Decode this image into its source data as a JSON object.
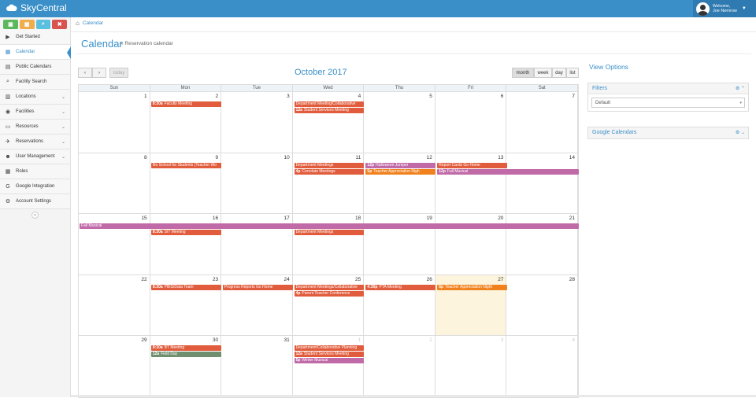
{
  "app": {
    "name": "SkyCentral"
  },
  "user": {
    "welcome": "Welcome,",
    "name": "Joe Nemrow"
  },
  "colors": {
    "brand": "#3a8fc8",
    "event_red": "#e15c3c",
    "event_orange": "#f0811d",
    "event_purple": "#c06aa8",
    "event_green": "#6f8f6e"
  },
  "quick_buttons": [
    {
      "icon": "calendar-plus-icon",
      "symbol": "▣",
      "color": "#5cb85c"
    },
    {
      "icon": "calendar-icon",
      "symbol": "▦",
      "color": "#f0ad4e"
    },
    {
      "icon": "search-icon",
      "symbol": "⌕",
      "color": "#5bc0de"
    },
    {
      "icon": "close-icon",
      "symbol": "✖",
      "color": "#d9534f"
    }
  ],
  "sidebar": {
    "items": [
      {
        "label": "Get Started",
        "icon": "play-icon",
        "symbol": "▶",
        "chevron": ""
      },
      {
        "label": "Calendar",
        "icon": "calendar-icon",
        "symbol": "▦",
        "chevron": "",
        "active": true
      },
      {
        "label": "Public Calendars",
        "icon": "document-icon",
        "symbol": "▤",
        "chevron": ""
      },
      {
        "label": "Facility Search",
        "icon": "search-icon",
        "symbol": "⌕",
        "chevron": ""
      },
      {
        "label": "Locations",
        "icon": "building-icon",
        "symbol": "▥",
        "chevron": "⌄"
      },
      {
        "label": "Facilities",
        "icon": "soccer-ball-icon",
        "symbol": "◉",
        "chevron": "⌄"
      },
      {
        "label": "Resources",
        "icon": "monitor-icon",
        "symbol": "▭",
        "chevron": "⌄"
      },
      {
        "label": "Reservations",
        "icon": "plane-icon",
        "symbol": "✈",
        "chevron": "⌄"
      },
      {
        "label": "User Management",
        "icon": "users-icon",
        "symbol": "☻",
        "chevron": "⌄"
      },
      {
        "label": "Roles",
        "icon": "grid-icon",
        "symbol": "▦",
        "chevron": ""
      },
      {
        "label": "Google Integration",
        "icon": "google-icon",
        "symbol": "G",
        "chevron": ""
      },
      {
        "label": "Account Settings",
        "icon": "gear-icon",
        "symbol": "⚙",
        "chevron": ""
      }
    ],
    "collapse_symbol": "«"
  },
  "breadcrumb": {
    "home_symbol": "⌂",
    "label": "Calendar"
  },
  "page": {
    "title": "Calendar",
    "subtitle": "» Reservation calendar"
  },
  "calendar": {
    "prev": "‹",
    "next": "›",
    "today": "today",
    "title": "October 2017",
    "views": [
      "month",
      "week",
      "day",
      "list"
    ],
    "active_view": "month",
    "weekdays": [
      "Sun",
      "Mon",
      "Tue",
      "Wed",
      "Thu",
      "Fri",
      "Sat"
    ],
    "weeks": [
      {
        "days": [
          {
            "n": "1"
          },
          {
            "n": "2"
          },
          {
            "n": "3"
          },
          {
            "n": "4"
          },
          {
            "n": "5"
          },
          {
            "n": "6"
          },
          {
            "n": "7"
          }
        ],
        "events": [
          {
            "col": 1,
            "span": 1,
            "row": 0,
            "time": "8:30a",
            "title": "Faculty Meeting",
            "color": "red"
          },
          {
            "col": 3,
            "span": 1,
            "row": 0,
            "time": "",
            "title": "Department Meeting/Collaborative",
            "color": "red"
          },
          {
            "col": 3,
            "span": 1,
            "row": 1,
            "time": "12a",
            "title": "Student Services Meeting",
            "color": "red"
          }
        ]
      },
      {
        "days": [
          {
            "n": "8"
          },
          {
            "n": "9"
          },
          {
            "n": "10"
          },
          {
            "n": "11"
          },
          {
            "n": "12"
          },
          {
            "n": "13"
          },
          {
            "n": "14"
          }
        ],
        "events": [
          {
            "col": 1,
            "span": 1,
            "row": 0,
            "time": "",
            "title": "No School for Students (Teacher Wo",
            "color": "red"
          },
          {
            "col": 3,
            "span": 1,
            "row": 0,
            "time": "",
            "title": "Department Meetings",
            "color": "red"
          },
          {
            "col": 3,
            "span": 1,
            "row": 1,
            "time": "4p",
            "title": "Correlate Meetings",
            "color": "red"
          },
          {
            "col": 4,
            "span": 1,
            "row": 0,
            "time": "12p",
            "title": "Halloween Jumper",
            "color": "purple"
          },
          {
            "col": 4,
            "span": 1,
            "row": 1,
            "time": "5p",
            "title": "Teacher Appreciation Nigh",
            "color": "orange"
          },
          {
            "col": 5,
            "span": 1,
            "row": 0,
            "time": "",
            "title": "Report Cards Go Home",
            "color": "red"
          },
          {
            "col": 5,
            "span": 2,
            "row": 1,
            "time": "12p",
            "title": "Fall Musical",
            "color": "purple"
          }
        ]
      },
      {
        "days": [
          {
            "n": "15"
          },
          {
            "n": "16"
          },
          {
            "n": "17"
          },
          {
            "n": "18"
          },
          {
            "n": "19"
          },
          {
            "n": "20"
          },
          {
            "n": "21"
          }
        ],
        "events": [
          {
            "col": 0,
            "span": 7,
            "row": 0,
            "time": "",
            "title": "Fall Musical",
            "color": "purple"
          },
          {
            "col": 1,
            "span": 1,
            "row": 1,
            "time": "8:30a",
            "title": "SIT Meeting",
            "color": "red"
          },
          {
            "col": 3,
            "span": 1,
            "row": 1,
            "time": "",
            "title": "Department Meetings",
            "color": "red"
          }
        ]
      },
      {
        "days": [
          {
            "n": "22"
          },
          {
            "n": "23"
          },
          {
            "n": "24"
          },
          {
            "n": "25"
          },
          {
            "n": "26"
          },
          {
            "n": "27",
            "today": true
          },
          {
            "n": "28"
          }
        ],
        "events": [
          {
            "col": 1,
            "span": 1,
            "row": 0,
            "time": "8:30a",
            "title": "PBIS/Data Team",
            "color": "red"
          },
          {
            "col": 2,
            "span": 1,
            "row": 0,
            "time": "",
            "title": "Progress Reports Go Home",
            "color": "red"
          },
          {
            "col": 3,
            "span": 1,
            "row": 0,
            "time": "",
            "title": "Department Meetings/Collaborative",
            "color": "red"
          },
          {
            "col": 3,
            "span": 1,
            "row": 1,
            "time": "4p",
            "title": "Parent Teacher Conference",
            "color": "red"
          },
          {
            "col": 4,
            "span": 1,
            "row": 0,
            "time": "4:30p",
            "title": "PTA Meeting",
            "color": "red"
          },
          {
            "col": 5,
            "span": 1,
            "row": 0,
            "time": "6p",
            "title": "Teacher Appreciation Night",
            "color": "orange"
          }
        ]
      },
      {
        "days": [
          {
            "n": "29"
          },
          {
            "n": "30"
          },
          {
            "n": "31"
          },
          {
            "n": "1",
            "other": true
          },
          {
            "n": "2",
            "other": true
          },
          {
            "n": "3",
            "other": true
          },
          {
            "n": "4",
            "other": true
          }
        ],
        "events": [
          {
            "col": 1,
            "span": 1,
            "row": 0,
            "time": "8:30a",
            "title": "BT Meeting",
            "color": "red"
          },
          {
            "col": 1,
            "span": 1,
            "row": 1,
            "time": "12a",
            "title": "Field Day",
            "color": "green"
          },
          {
            "col": 3,
            "span": 1,
            "row": 0,
            "time": "",
            "title": "Department/Collaborative Planning",
            "color": "red"
          },
          {
            "col": 3,
            "span": 1,
            "row": 1,
            "time": "12a",
            "title": "Student Services Meeting",
            "color": "red"
          },
          {
            "col": 3,
            "span": 1,
            "row": 2,
            "time": "5p",
            "title": "Winter Musical",
            "color": "purple"
          }
        ]
      }
    ]
  },
  "view_options": {
    "title": "View Options",
    "filters": {
      "title": "Filters",
      "tools": "⚙ ⌃",
      "selected": "Default",
      "arrow": "▾"
    },
    "google": {
      "title": "Google Calendars",
      "tools": "⚙ ⌄"
    }
  }
}
